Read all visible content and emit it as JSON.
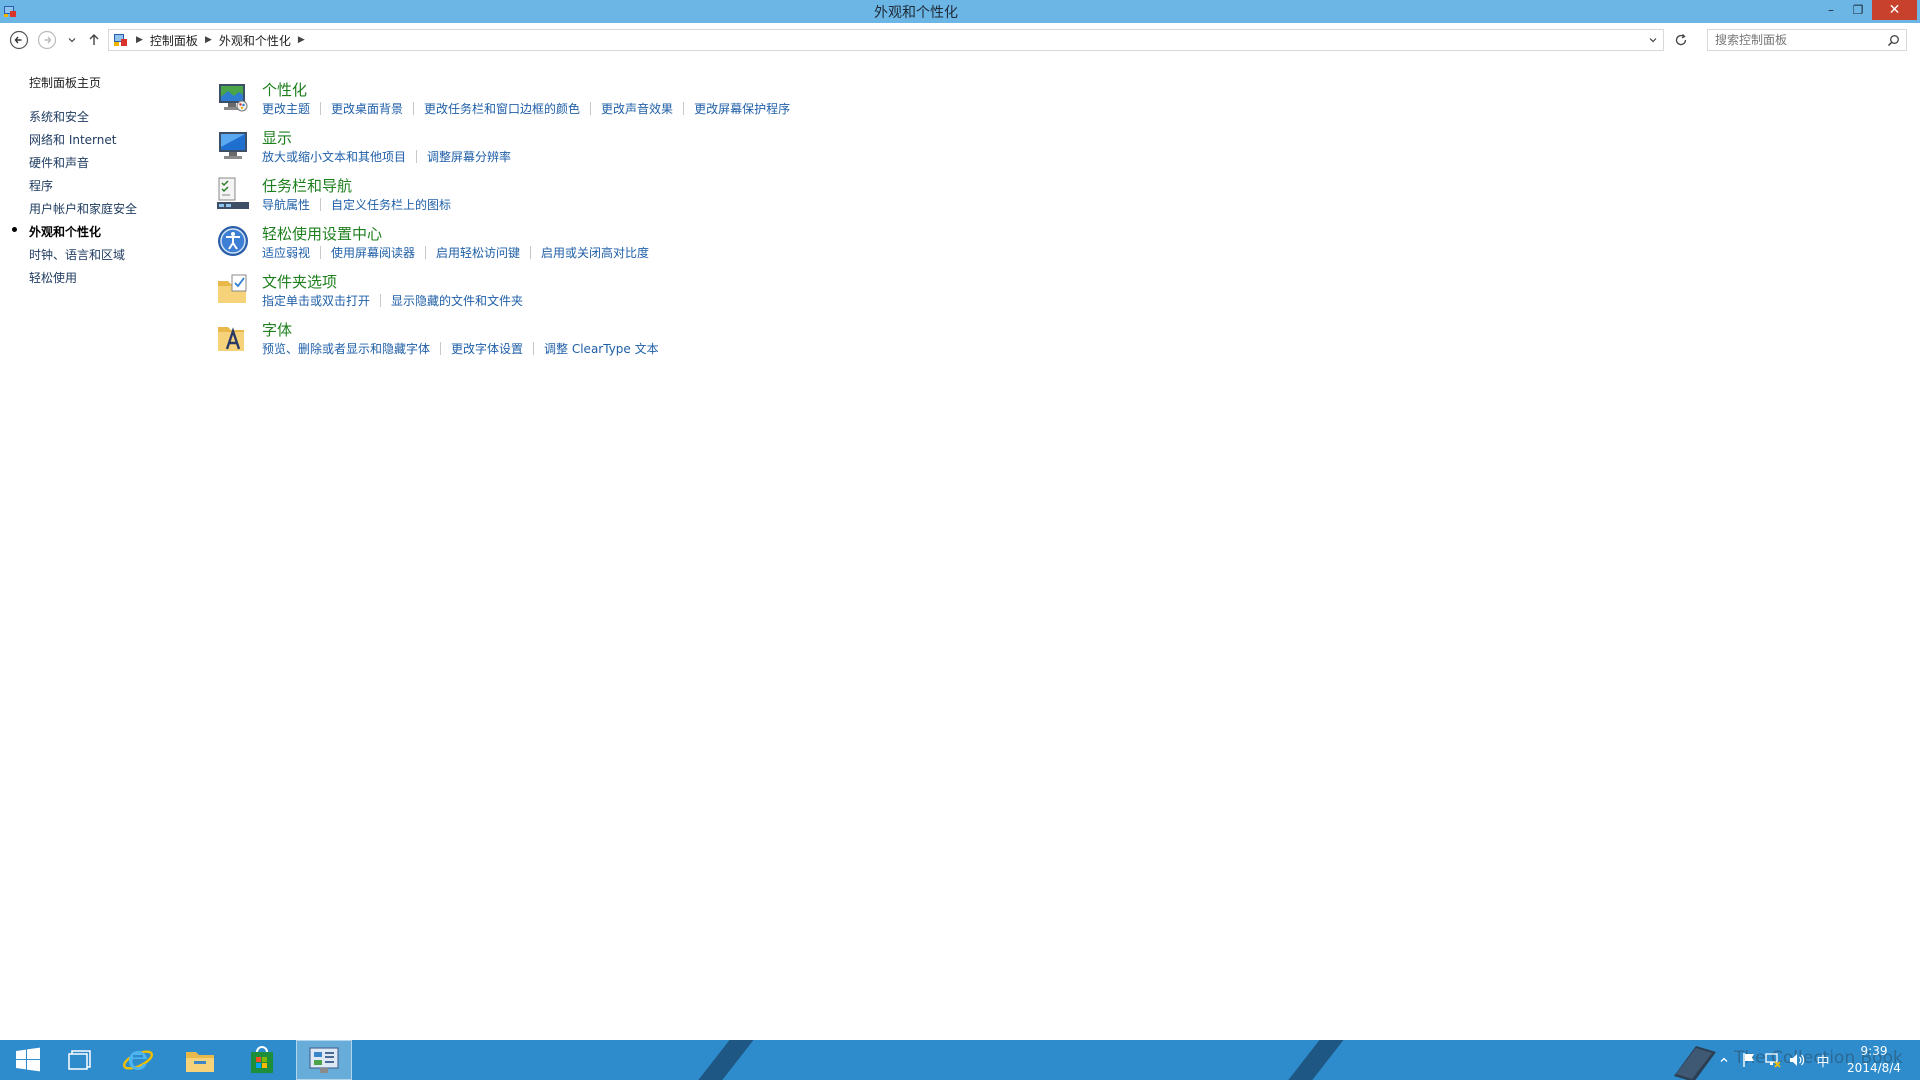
{
  "window": {
    "title": "外观和个性化",
    "minimize_label": "–",
    "restore_label": "❐",
    "close_label": "✕"
  },
  "address": {
    "segments": [
      "控制面板",
      "外观和个性化"
    ],
    "search_placeholder": "搜索控制面板"
  },
  "leftnav": {
    "home": "控制面板主页",
    "items": [
      {
        "label": "系统和安全"
      },
      {
        "label": "网络和 Internet"
      },
      {
        "label": "硬件和声音"
      },
      {
        "label": "程序"
      },
      {
        "label": "用户帐户和家庭安全"
      },
      {
        "label": "外观和个性化",
        "active": true
      },
      {
        "label": "时钟、语言和区域"
      },
      {
        "label": "轻松使用"
      }
    ]
  },
  "categories": [
    {
      "title": "个性化",
      "icon": "personalization-icon",
      "links": [
        "更改主题",
        "更改桌面背景",
        "更改任务栏和窗口边框的颜色",
        "更改声音效果",
        "更改屏幕保护程序"
      ]
    },
    {
      "title": "显示",
      "icon": "display-icon",
      "links": [
        "放大或缩小文本和其他项目",
        "调整屏幕分辨率"
      ]
    },
    {
      "title": "任务栏和导航",
      "icon": "taskbar-icon",
      "links": [
        "导航属性",
        "自定义任务栏上的图标"
      ]
    },
    {
      "title": "轻松使用设置中心",
      "icon": "ease-of-access-icon",
      "links": [
        "适应弱视",
        "使用屏幕阅读器",
        "启用轻松访问键",
        "启用或关闭高对比度"
      ]
    },
    {
      "title": "文件夹选项",
      "icon": "folder-options-icon",
      "links": [
        "指定单击或双击打开",
        "显示隐藏的文件和文件夹"
      ]
    },
    {
      "title": "字体",
      "icon": "fonts-icon",
      "links": [
        "预览、删除或者显示和隐藏字体",
        "更改字体设置",
        "调整 ClearType 文本"
      ]
    }
  ],
  "taskbar": {
    "apps": [
      "start-icon",
      "task-view-icon",
      "internet-explorer-icon",
      "file-explorer-icon",
      "store-icon",
      "control-panel-icon"
    ],
    "watermark": "The Collection Book",
    "ime_label": "中",
    "time": "9:39",
    "date": "2014/8/4"
  },
  "colors": {
    "titlebar": "#6cb6e6",
    "taskbar": "#2e8ccc",
    "category_title": "#1e7f1e",
    "link": "#1f5fa8",
    "close_button": "#c7412d"
  }
}
